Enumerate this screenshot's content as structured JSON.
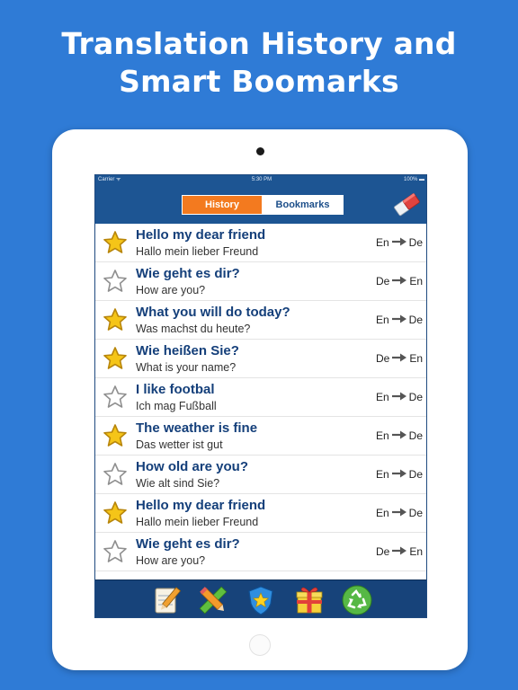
{
  "promo": {
    "line1": "Translation History and",
    "line2": "Smart Boomarks"
  },
  "status": {
    "carrier": "Carrier ᯤ",
    "time": "5:30 PM",
    "battery": "100% ▬"
  },
  "tabs": [
    {
      "label": "History",
      "active": true
    },
    {
      "label": "Bookmarks",
      "active": false
    }
  ],
  "rows": [
    {
      "source": "Hello my dear friend",
      "translation": "Hallo mein lieber Freund",
      "from": "En",
      "to": "De",
      "starred": true
    },
    {
      "source": "Wie geht es dir?",
      "translation": "How are you?",
      "from": "De",
      "to": "En",
      "starred": false
    },
    {
      "source": "What you will do today?",
      "translation": "Was machst du heute?",
      "from": "En",
      "to": "De",
      "starred": true
    },
    {
      "source": "Wie heißen Sie?",
      "translation": "What is your name?",
      "from": "De",
      "to": "En",
      "starred": true
    },
    {
      "source": "I like footbal",
      "translation": "Ich mag Fußball",
      "from": "En",
      "to": "De",
      "starred": false
    },
    {
      "source": "The weather is fine",
      "translation": "Das wetter ist gut",
      "from": "En",
      "to": "De",
      "starred": true
    },
    {
      "source": "How old are you?",
      "translation": "Wie alt sind Sie?",
      "from": "En",
      "to": "De",
      "starred": false
    },
    {
      "source": "Hello my dear friend",
      "translation": "Hallo mein lieber Freund",
      "from": "En",
      "to": "De",
      "starred": true
    },
    {
      "source": "Wie geht es dir?",
      "translation": "How are you?",
      "from": "De",
      "to": "En",
      "starred": false
    }
  ],
  "toolbar": [
    "notepad-icon",
    "pencil-ruler-icon",
    "shield-star-icon",
    "gift-icon",
    "recycle-icon"
  ],
  "colors": {
    "background": "#2f7bd6",
    "navbar": "#1d5593",
    "tab_active": "#f37a1f",
    "source_text": "#143f7a",
    "star_gold": "#f5c518",
    "toolbar": "#17437a"
  }
}
